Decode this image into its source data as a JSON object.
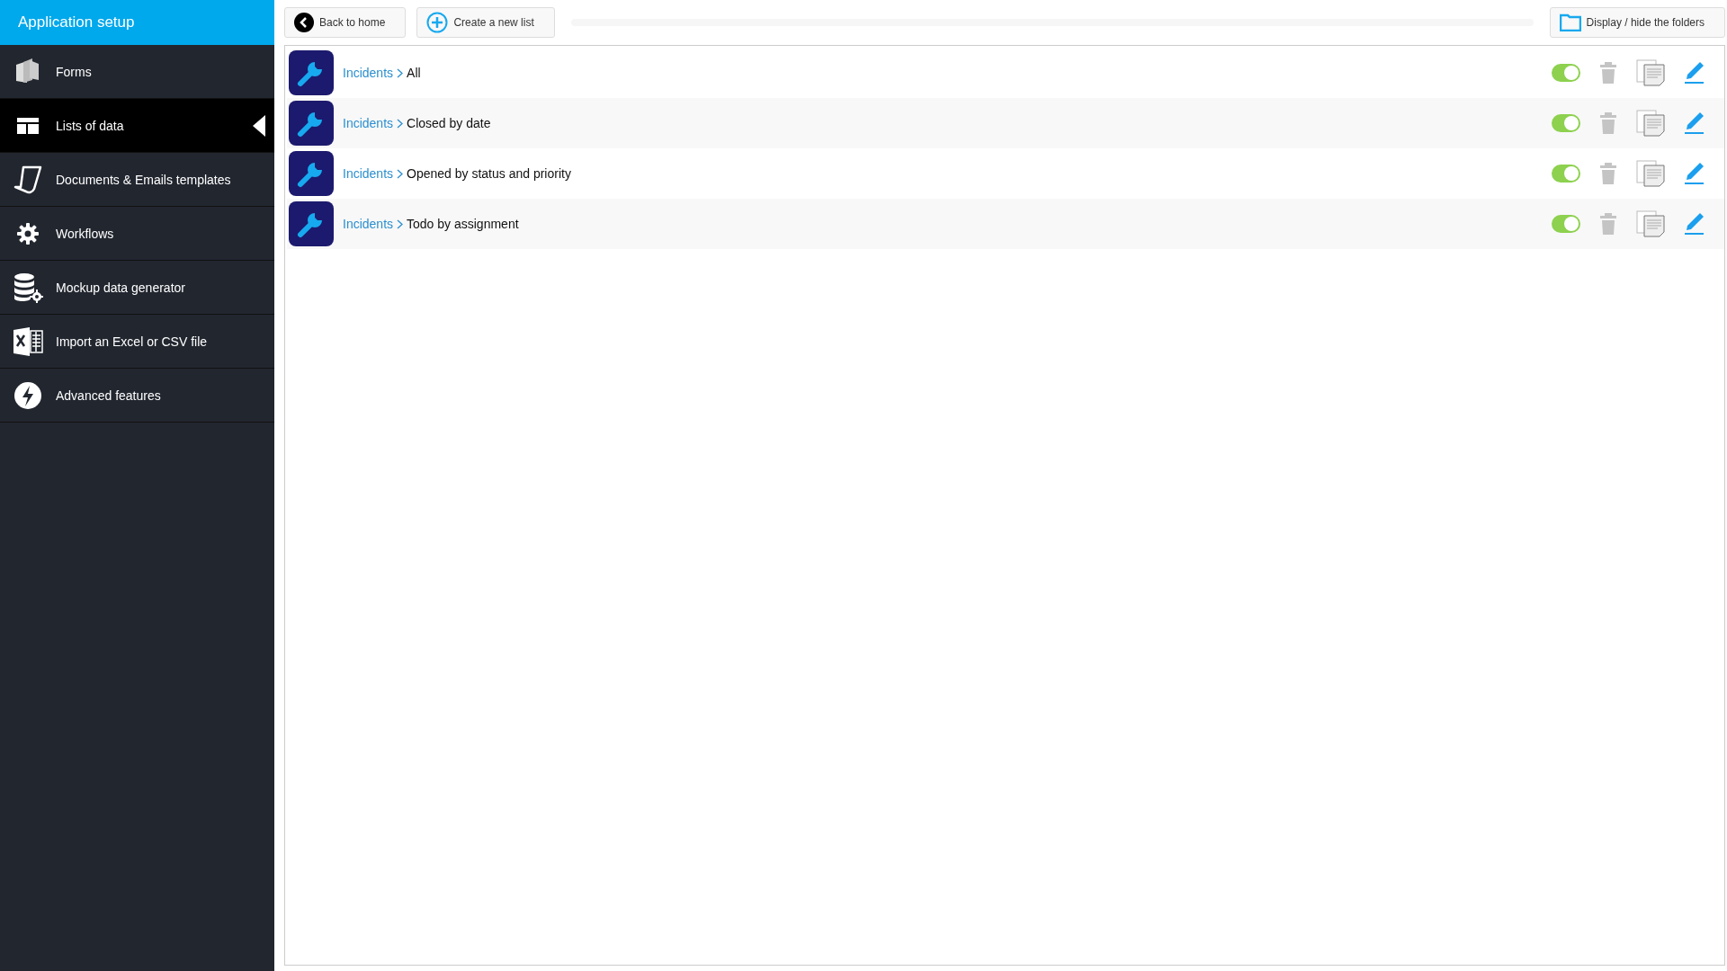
{
  "sidebar": {
    "title": "Application setup",
    "items": [
      {
        "label": "Forms",
        "selected": false
      },
      {
        "label": "Lists of data",
        "selected": true
      },
      {
        "label": "Documents & Emails templates",
        "selected": false
      },
      {
        "label": "Workflows",
        "selected": false
      },
      {
        "label": "Mockup data generator",
        "selected": false
      },
      {
        "label": "Import an Excel or CSV file",
        "selected": false
      },
      {
        "label": "Advanced features",
        "selected": false
      }
    ]
  },
  "toolbar": {
    "back_button": "Back to home",
    "create_button": "Create a new list",
    "folders_button": "Display / hide the folders"
  },
  "lists": [
    {
      "folder": "Incidents",
      "name": "All",
      "enabled": true
    },
    {
      "folder": "Incidents",
      "name": "Closed by date",
      "enabled": true
    },
    {
      "folder": "Incidents",
      "name": "Opened by status and priority",
      "enabled": true
    },
    {
      "folder": "Incidents",
      "name": "Todo by assignment",
      "enabled": true
    }
  ]
}
